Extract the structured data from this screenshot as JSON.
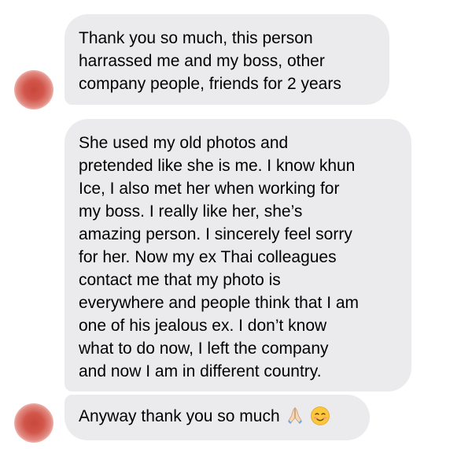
{
  "messages": [
    {
      "lines": [
        "Thank you so much, this person",
        "harrassed me and my boss, other",
        "company people, friends for 2 years"
      ]
    },
    {
      "lines": [
        "She used my old photos and",
        "pretended like she is me. I know khun",
        "Ice, I also met her when working for",
        "my boss. I really like her, she’s",
        "amazing person. I sincerely feel sorry",
        "for her. Now my ex Thai colleagues",
        "contact me that my photo is",
        "everywhere and people think that I am",
        "one of his jealous ex. I don’t know",
        "what to do now, I left the company",
        "and now I am in different country."
      ]
    },
    {
      "text": "Anyway thank you so much",
      "emojis": [
        "praying-hands-icon",
        "smiling-face-icon"
      ]
    }
  ],
  "colors": {
    "bubble": "#ebebed",
    "text": "#000000",
    "avatar": "#d2564b"
  }
}
